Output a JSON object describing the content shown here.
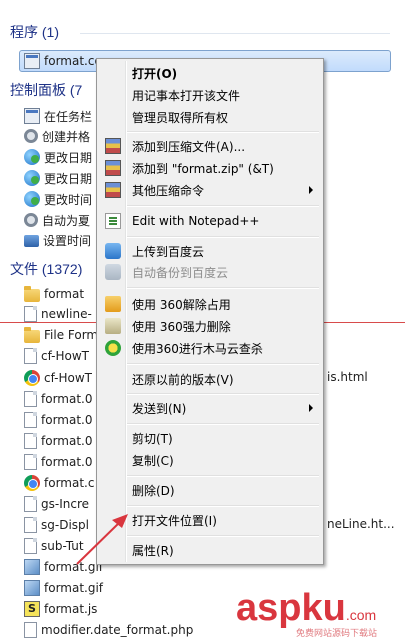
{
  "sections": {
    "programs": {
      "heading": "程序 (1)"
    },
    "control_panel": {
      "heading": "控制面板 (7"
    },
    "files": {
      "heading": "文件 (1372)"
    }
  },
  "programs_items": [
    {
      "label": "format.com",
      "icon": "exe-icon"
    }
  ],
  "control_panel_items": [
    {
      "label": "在任务栏",
      "icon": "taskbar-icon"
    },
    {
      "label": "创建并格",
      "icon": "disk-icon"
    },
    {
      "label": "更改日期",
      "icon": "globe-icon"
    },
    {
      "label": "更改日期",
      "icon": "globe-icon"
    },
    {
      "label": "更改时间",
      "icon": "globe-icon"
    },
    {
      "label": "自动为夏",
      "icon": "clock-icon"
    },
    {
      "label": "设置时间",
      "icon": "network-icon"
    }
  ],
  "file_items": [
    {
      "label": "format",
      "icon": "folder-icon"
    },
    {
      "label": "newline-",
      "icon": "document-icon"
    },
    {
      "label": "File Form",
      "icon": "folder-icon"
    },
    {
      "label": "cf-HowT",
      "icon": "document-icon"
    },
    {
      "label": "cf-HowT",
      "icon": "chrome-icon",
      "suffix": "is.html"
    },
    {
      "label": "format.0",
      "icon": "document-icon"
    },
    {
      "label": "format.0",
      "icon": "document-icon"
    },
    {
      "label": "format.0",
      "icon": "document-icon"
    },
    {
      "label": "format.0",
      "icon": "document-icon"
    },
    {
      "label": "format.c",
      "icon": "chrome-icon"
    },
    {
      "label": "gs-Incre",
      "icon": "document-icon"
    },
    {
      "label": "sg-Displ",
      "icon": "document-icon",
      "suffix": "neLine.ht..."
    },
    {
      "label": "sub-Tut",
      "icon": "document-icon"
    },
    {
      "label": "format.gif",
      "icon": "gif-icon"
    },
    {
      "label": "format.gif",
      "icon": "gif-icon"
    },
    {
      "label": "format.js",
      "icon": "js-icon"
    },
    {
      "label": "modifier.date_format.php",
      "icon": "php-icon"
    }
  ],
  "context_menu": {
    "items": [
      {
        "label": "打开(O)",
        "bold": true
      },
      {
        "label": "用记事本打开该文件"
      },
      {
        "label": "管理员取得所有权"
      },
      {
        "sep": true
      },
      {
        "label": "添加到压缩文件(A)...",
        "icon": "winrar-icon"
      },
      {
        "label": "添加到 \"format.zip\" (&T)",
        "icon": "winrar-icon"
      },
      {
        "label": "其他压缩命令",
        "icon": "winrar-icon",
        "submenu": true
      },
      {
        "sep": true
      },
      {
        "label": "Edit with Notepad++",
        "icon": "notepadpp-icon"
      },
      {
        "sep": true
      },
      {
        "label": "上传到百度云",
        "icon": "baidu-cloud-icon"
      },
      {
        "label": "自动备份到百度云",
        "icon": "baidu-cloud-icon",
        "disabled": true
      },
      {
        "sep": true
      },
      {
        "label": "使用 360解除占用",
        "icon": "360-unlock-icon"
      },
      {
        "label": "使用 360强力删除",
        "icon": "360-delete-icon"
      },
      {
        "label": "使用360进行木马云查杀",
        "icon": "360-scan-icon"
      },
      {
        "sep": true
      },
      {
        "label": "还原以前的版本(V)"
      },
      {
        "sep": true
      },
      {
        "label": "发送到(N)",
        "submenu": true
      },
      {
        "sep": true
      },
      {
        "label": "剪切(T)"
      },
      {
        "label": "复制(C)"
      },
      {
        "sep": true
      },
      {
        "label": "删除(D)"
      },
      {
        "sep": true
      },
      {
        "label": "打开文件位置(I)"
      },
      {
        "sep": true
      },
      {
        "label": "属性(R)"
      }
    ]
  },
  "watermark": {
    "brand": "aspku",
    "tld": ".com",
    "tagline": "免费网站源码下载站"
  },
  "colors": {
    "heading": "#1e3287",
    "annotation": "#d9363e",
    "selection": "#cfe3fc"
  }
}
